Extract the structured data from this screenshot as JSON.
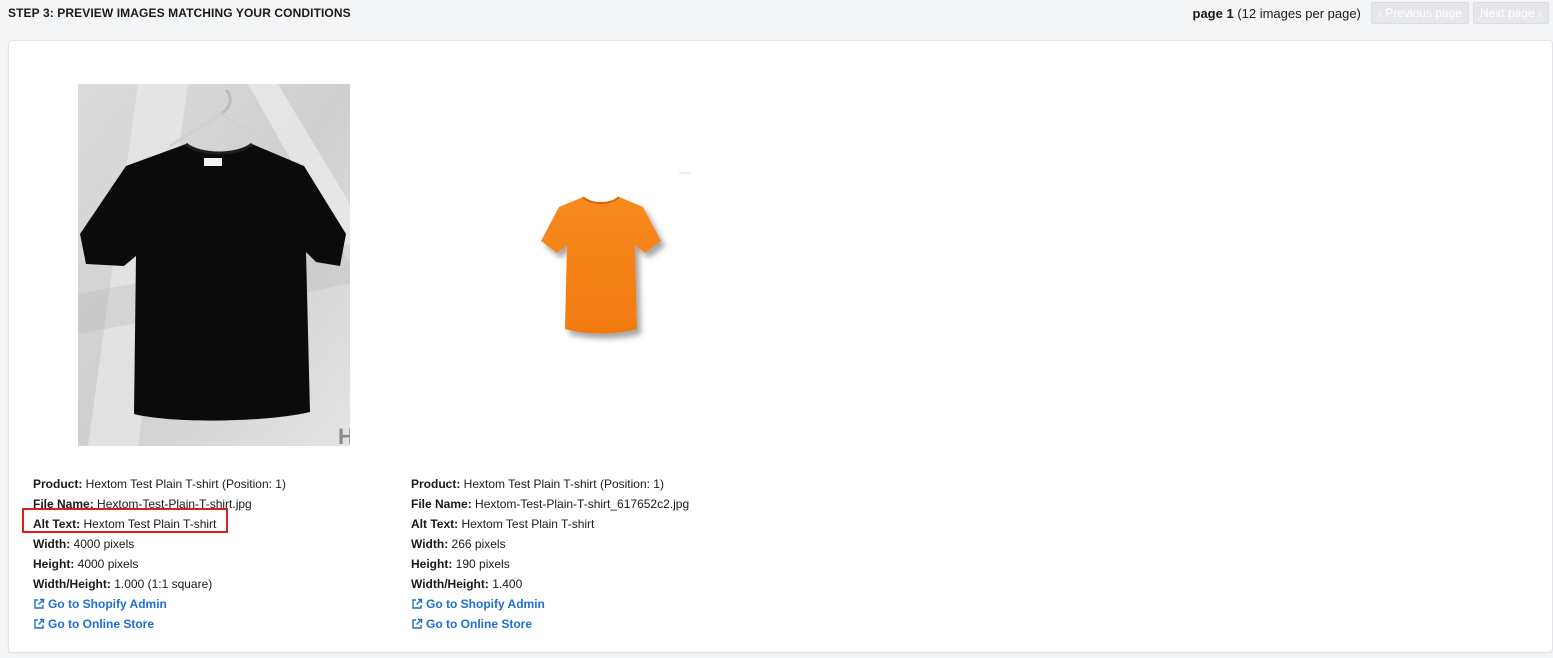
{
  "header": {
    "step_title": "STEP 3: PREVIEW IMAGES MATCHING YOUR CONDITIONS",
    "page_word": "page 1",
    "page_info": " (12 images per page)",
    "prev_label": "Previous page",
    "next_label": "Next page"
  },
  "images": [
    {
      "product_label": "Product:",
      "product": " Hextom Test Plain T-shirt (Position: 1)",
      "file_label": "File Name:",
      "file_name": " Hextom-Test-Plain-T-shirt.jpg",
      "alt_label": "Alt Text:",
      "alt_text": " Hextom Test Plain T-shirt",
      "width_label": "Width:",
      "width": " 4000 pixels",
      "height_label": "Height:",
      "height": " 4000 pixels",
      "ratio_label": "Width/Height:",
      "ratio": " 1.000 (1:1 square)",
      "admin_link": "Go to Shopify Admin",
      "store_link": "Go to Online Store",
      "watermark": "H"
    },
    {
      "product_label": "Product:",
      "product": " Hextom Test Plain T-shirt (Position: 1)",
      "file_label": "File Name:",
      "file_name": " Hextom-Test-Plain-T-shirt_617652c2.jpg",
      "alt_label": "Alt Text:",
      "alt_text": " Hextom Test Plain T-shirt",
      "width_label": "Width:",
      "width": " 266 pixels",
      "height_label": "Height:",
      "height": " 190 pixels",
      "ratio_label": "Width/Height:",
      "ratio": " 1.400",
      "admin_link": "Go to Shopify Admin",
      "store_link": "Go to Online Store"
    }
  ],
  "colors": {
    "link": "#1f6fd0",
    "highlight": "#d92121",
    "shirt_black": "#0b0b0b",
    "shirt_orange": "#f57f17"
  },
  "icons": {
    "prev": "chevron-left-icon",
    "next": "chevron-right-icon",
    "link": "external-link-icon"
  }
}
